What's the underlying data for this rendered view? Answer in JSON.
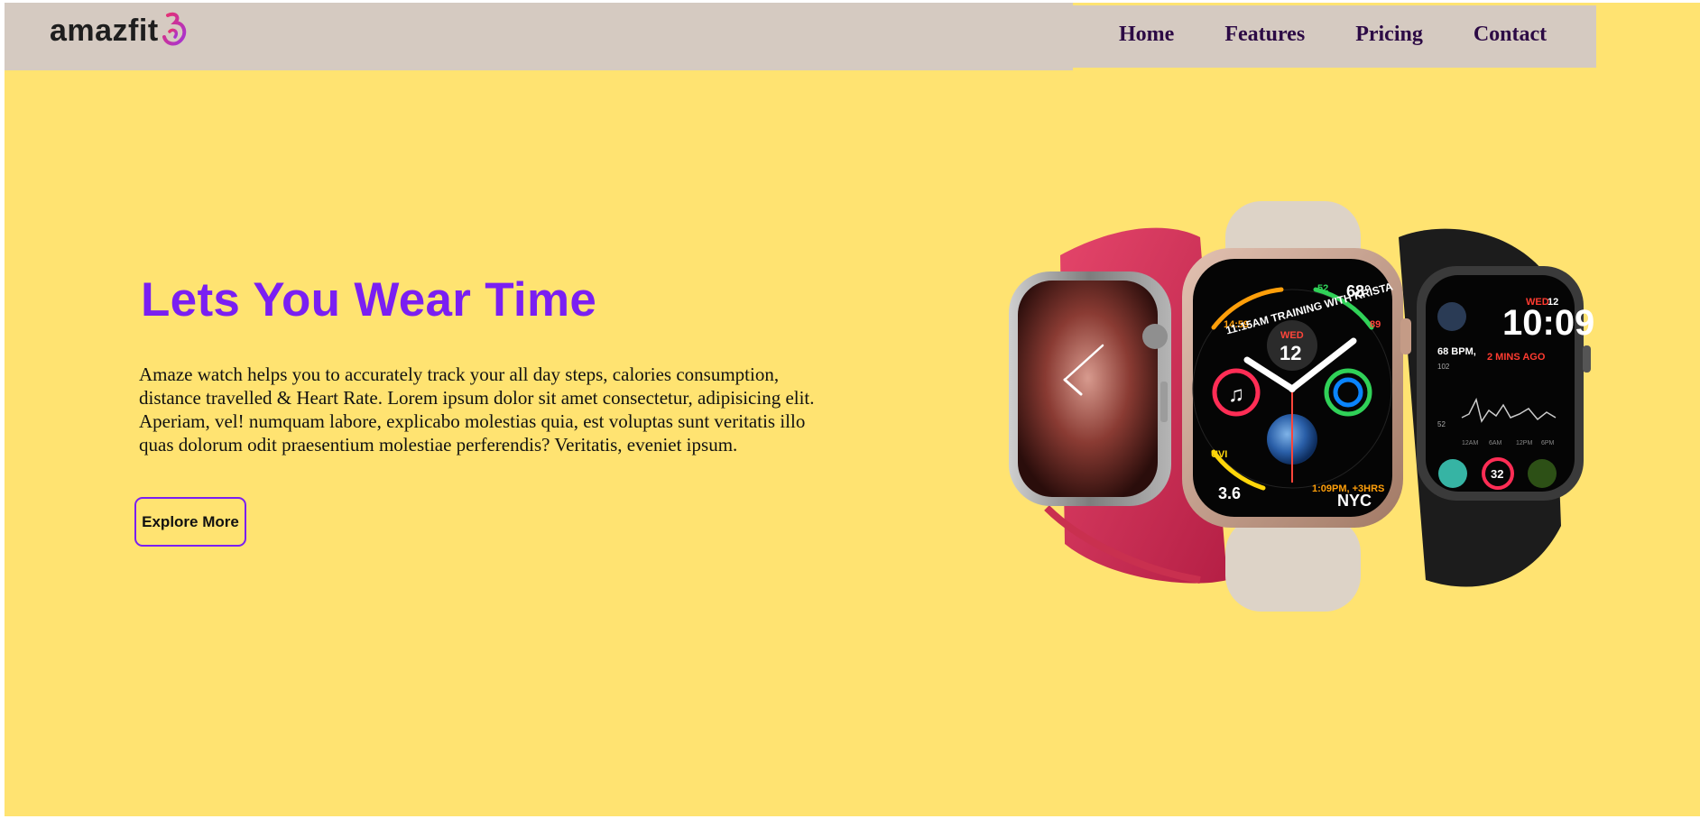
{
  "brand": {
    "logo_text": "amazfit",
    "colors": {
      "nav_bg": "#D5CAC1",
      "page_bg": "#FFE371",
      "accent": "#7A1FF2",
      "nav_text": "#2C0A45"
    }
  },
  "nav": {
    "items": [
      {
        "label": "Home"
      },
      {
        "label": "Features"
      },
      {
        "label": "Pricing"
      },
      {
        "label": "Contact"
      }
    ]
  },
  "hero": {
    "title": "Lets You Wear Time",
    "description": "Amaze watch helps you to accurately track your all day steps, calories consumption, distance travelled & Heart Rate. Lorem ipsum dolor sit amet consectetur, adipisicing elit. Aperiam, vel! numquam labore, explicabo molestias quia, est voluptas sunt veritatis illo quas dolorum odit praesentium molestiae perferendis? Veritatis, eveniet ipsum.",
    "cta_label": "Explore More"
  },
  "watches": {
    "center_face": {
      "day": "WED",
      "date": "12",
      "top_text": "11:15AM TRAINING WITH KRISTA",
      "top_left": "14:59",
      "top_right_a": "52",
      "top_right_b": "68°",
      "top_right_c": "89",
      "bottom_left_label": "UVI",
      "bottom_left_value": "3.6",
      "bottom_right_text": "1:09PM, +3HRS",
      "bottom_right_city": "NYC"
    },
    "right_face": {
      "day": "WED",
      "date": "12",
      "time": "10:09",
      "bpm": "68 BPM,",
      "ago": "2 MINS AGO",
      "tick_a": "102",
      "tick_b": "52",
      "axis_a": "12AM",
      "axis_b": "6AM",
      "axis_c": "12PM",
      "axis_d": "6PM",
      "ring_value": "32"
    }
  }
}
